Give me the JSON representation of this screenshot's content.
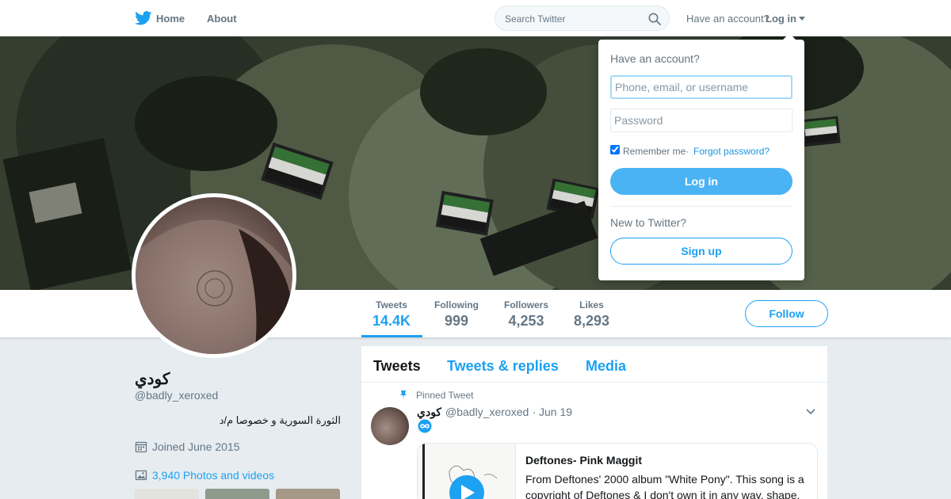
{
  "colors": {
    "accent": "#1da1f2",
    "login_button": "#4ab3f4",
    "page_bg": "#e6ecf0",
    "muted": "#657786"
  },
  "nav": {
    "logo_icon": "twitter-bird-icon",
    "home_label": "Home",
    "about_label": "About",
    "search_placeholder": "Search Twitter",
    "search_icon": "search-icon",
    "have_account": "Have an account?",
    "login_label": "Log in"
  },
  "login_dropdown": {
    "title": "Have an account?",
    "username_placeholder": "Phone, email, or username",
    "password_placeholder": "Password",
    "remember_label": "Remember me",
    "separator": "·",
    "forgot_label": "Forgot password?",
    "login_button": "Log in",
    "new_prompt": "New to Twitter?",
    "signup_button": "Sign up"
  },
  "stats": [
    {
      "label": "Tweets",
      "value": "14.4K"
    },
    {
      "label": "Following",
      "value": "999"
    },
    {
      "label": "Followers",
      "value": "4,253"
    },
    {
      "label": "Likes",
      "value": "8,293"
    }
  ],
  "follow_label": "Follow",
  "profile": {
    "name": "كودي",
    "handle": "@badly_xeroxed",
    "bio": "الثورة السورية و خصوصا م/د",
    "joined": "Joined June 2015",
    "joined_icon": "calendar-icon",
    "photos": "3,940 Photos and videos",
    "photos_icon": "image-icon"
  },
  "timeline": {
    "tabs": [
      "Tweets",
      "Tweets & replies",
      "Media"
    ],
    "pinned_label": "Pinned Tweet",
    "pinned_icon": "pin-icon",
    "tweet": {
      "name": "كودي",
      "handle": "@badly_xeroxed",
      "separator": "·",
      "date": "Jun 19",
      "badge_icon": "infinity-icon",
      "card": {
        "title": "Deftones- Pink Maggit",
        "description": "From Deftones' 2000 album \"White Pony\". This song is a copyright of Deftones & I don't own it in any way, shape,",
        "play_icon": "play-icon"
      }
    }
  }
}
